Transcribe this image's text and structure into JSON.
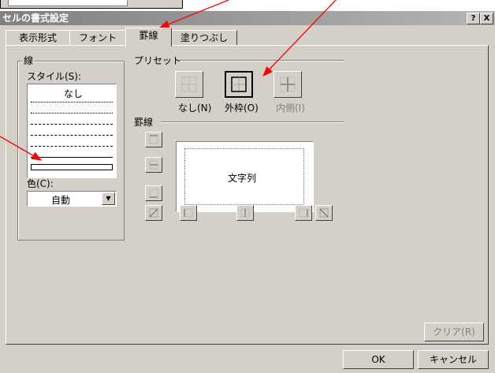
{
  "dialog": {
    "title": "セルの書式設定",
    "help_button": "?",
    "close_button": "X"
  },
  "tabs": [
    {
      "label": "表示形式"
    },
    {
      "label": "フォント"
    },
    {
      "label": "罫線"
    },
    {
      "label": "塗りつぶし"
    }
  ],
  "line_group": {
    "title": "線",
    "style_label": "スタイル(S):",
    "style_none": "なし",
    "color_label": "色(C):",
    "color_value": "自動"
  },
  "preset_group": {
    "title": "プリセット",
    "buttons": [
      {
        "label": "なし(N)"
      },
      {
        "label": "外枠(O)"
      },
      {
        "label": "内側(I)"
      }
    ]
  },
  "border_group": {
    "title": "罫線",
    "preview_text": "文字列"
  },
  "buttons": {
    "clear": "クリア(R)",
    "ok": "OK",
    "cancel": "キャンセル"
  },
  "colors": {
    "face": "#d4d0c8",
    "annotation_arrow": "#ff0000"
  }
}
